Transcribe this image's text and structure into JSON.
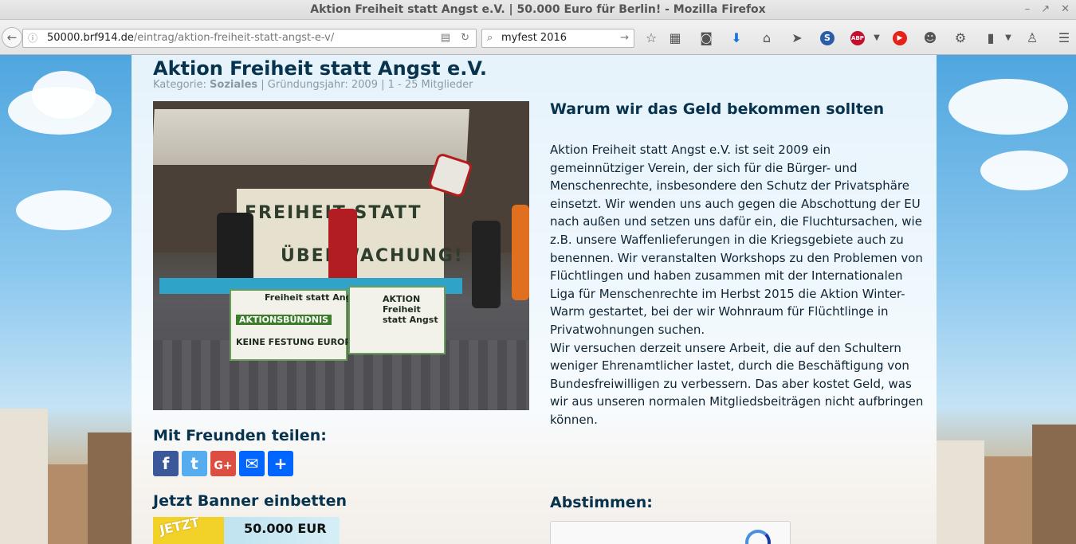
{
  "browser": {
    "window_title": "Aktion Freiheit statt Angst e.V. | 50.000 Euro für Berlin! - Mozilla Firefox",
    "url_host": "50000.brf914.de",
    "url_path": "/eintrag/aktion-freiheit-statt-angst-e-v/",
    "search_value": "myfest 2016"
  },
  "entry": {
    "title": "Aktion Freiheit statt Angst e.V.",
    "meta_category_label": "Kategorie: ",
    "meta_category": "Soziales",
    "meta_rest": " | Gründungsjahr: 2009 | 1 - 25 Mitglieder"
  },
  "photo": {
    "banner_line1": "FREIHEIT STATT",
    "banner_line2": "ÜBERWACHUNG!",
    "sign1_title": "Freiheit statt Angst",
    "sign1_sub": "AKTIONSBÜNDNIS",
    "sign1_footer": "KEINE FESTUNG EUROPA",
    "sign2_title": "AKTION Freiheit statt Angst"
  },
  "share": {
    "heading": "Mit Freunden teilen:",
    "buttons": [
      {
        "label": "f",
        "icon": "facebook-icon",
        "color": "#3b5998"
      },
      {
        "label": "t",
        "icon": "twitter-icon",
        "color": "#55acee"
      },
      {
        "label": "G+",
        "icon": "google-plus-icon",
        "color": "#dc4e41"
      },
      {
        "label": "✉",
        "icon": "email-icon",
        "color": "#0166ff"
      },
      {
        "label": "+",
        "icon": "share-plus-icon",
        "color": "#0166ff"
      }
    ]
  },
  "embed": {
    "heading": "Jetzt Banner einbetten",
    "banner_jetzt": "JETZT",
    "banner_amount": "50.000 EUR"
  },
  "why": {
    "heading": "Warum wir das Geld bekommen sollten",
    "paragraph1": "Aktion Freiheit statt Angst e.V. ist seit 2009 ein gemeinnütziger Verein, der sich für die Bürger- und Menschenrechte, insbesondere den Schutz der Privatsphäre einsetzt. Wir wenden uns auch gegen die Abschottung der EU nach außen und setzen uns dafür ein, die Fluchtursachen, wie z.B. unsere Waffenlieferungen in die Kriegsgebiete auch zu benennen. Wir veranstalten Workshops zu den Problemen von Flüchtlingen und haben zusammen mit der Internationalen Liga für Menschenrechte im Herbst 2015 die Aktion Winter-Warm gestartet, bei der wir Wohnraum für Flüchtlinge in Privatwohnungen suchen.",
    "paragraph2": "Wir versuchen derzeit unsere Arbeit, die auf den Schultern weniger Ehrenamtlicher lastet, durch die Beschäftigung von Bundesfreiwilligen zu verbessern. Das aber kostet Geld, was wir aus unseren normalen Mitgliedsbeiträgen nicht aufbringen können."
  },
  "vote": {
    "heading": "Abstimmen:"
  }
}
